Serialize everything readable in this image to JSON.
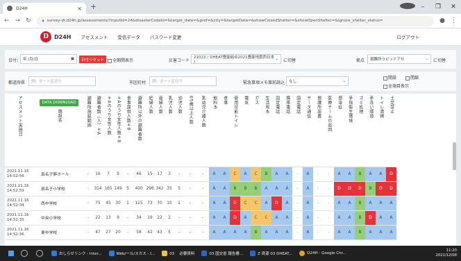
{
  "browser": {
    "tab_title": "D24H",
    "url": "survey-dr.d24h.jp/assessments/?inputId=24&disasterCodeId=&target_date=&pref=&city=&targetData=&showClosedShelter=&showOpenShelter=&ignore_shelter_status="
  },
  "nav": {
    "brand": "D24H",
    "links": [
      "アセスメント",
      "受信データ",
      "パスワード変更"
    ],
    "logout": "ログアウト"
  },
  "filters": {
    "date_label": "日付：",
    "date_value": "年 /月/日",
    "today_button": "日付リセット",
    "show_all_label": "全期間表示",
    "disaster_code_label": "災害コード",
    "disaster_code_value": "21023 ( DHEAT豊能組合2021豊能地震西日本 )",
    "copy_label": "に切替",
    "shelter_label": "拠点",
    "shelter_value": "避難所ラピッドアセ",
    "pref_label": "都道府県",
    "pref_placeholder": "例）ダ一ト区切り",
    "city_label": "市区町村",
    "city_placeholder": "例）ダ一ト区切り",
    "memo_label": "緊急事項メモ事前読込",
    "memo_value": "なし",
    "cb_open": "開設",
    "cb_closed": "閉鎖",
    "cb_all": "全項目表示"
  },
  "table": {
    "download_label": "DATA DOWNLOAD",
    "headers": {
      "date": "アセスメント実施日",
      "name": "施設名",
      "nums": [
        "避難所施設範囲",
        "避難者数（人）＊A",
        "＊Aのうち女性人数",
        "＊Aのうち女性人数＊B",
        "食事提供人数＊B",
        "避難所以外の避難者数",
        "妊婦人数",
        "産婦人数",
        "乳児人数",
        "幼児人数",
        "65歳以上人数",
        "乳幼児介護人数"
      ],
      "grades": [
        "飲料水",
        "食事",
        "使用可能トイレ",
        "電気",
        "ガス",
        "生活用水",
        "固定電話",
        "携帯電話",
        "固定電話",
        "データ通信",
        "救護所設置",
        "医療チームの巡回",
        "感染症",
        "手指衛生環境",
        "ゴミ処理",
        "手洗い環境",
        "トイレ清掃",
        "土足禁止"
      ]
    },
    "rows": [
      {
        "date": "2021.11.16",
        "time": "14:52:56",
        "name": "真名子夢ホール",
        "nums": [
          "-",
          "16",
          "7",
          "9",
          "-",
          "46",
          "15",
          "17",
          "3",
          "-",
          "-",
          "-"
        ],
        "grades": [
          "A",
          "A",
          "C",
          "A",
          "C",
          "B",
          "A",
          "A",
          "-",
          "A",
          "-",
          "-",
          "A",
          "A",
          "B",
          "A",
          "A",
          "D"
        ]
      },
      {
        "date": "2021.11.16",
        "time": "14:52:59",
        "name": "真名子小学校",
        "nums": [
          "-",
          "314",
          "165",
          "149",
          "5",
          "400",
          "298",
          "342",
          "35",
          "5",
          "-",
          "-"
        ],
        "grades": [
          "A",
          "A",
          "B",
          "B",
          "B",
          "A",
          "A",
          "A",
          "-",
          "A",
          "-",
          "-",
          "D",
          "D",
          "D",
          "B",
          "D",
          "D"
        ]
      },
      {
        "date": "2021.11.16",
        "time": "14:52:34",
        "name": "西中学校",
        "nums": [
          "-",
          "75",
          "45",
          "30",
          "1",
          "115",
          "73",
          "70",
          "10",
          "1",
          "-",
          "-"
        ],
        "grades": [
          "A",
          "A",
          "D",
          "C",
          "C",
          "A",
          "D",
          "A",
          "-",
          "A",
          "-",
          "-",
          "A",
          "A",
          "B",
          "A",
          "A",
          "A"
        ]
      },
      {
        "date": "2021.11.16",
        "time": "14:52:35",
        "name": "中央小学校",
        "nums": [
          "-",
          "22",
          "13",
          "9",
          "-",
          "34",
          "19",
          "22",
          "2",
          "-",
          "-",
          "-"
        ],
        "grades": [
          "A",
          "A",
          "D",
          "A",
          "C",
          "C",
          "A",
          "A",
          "-",
          "A",
          "-",
          "-",
          "A",
          "A",
          "B",
          "D",
          "A",
          "A"
        ]
      },
      {
        "date": "2021.11.16",
        "time": "14:52:36",
        "name": "東中学校",
        "nums": [
          "-",
          "47",
          "27",
          "20",
          "-",
          "58",
          "42",
          "43",
          "5",
          "-",
          "-",
          "-"
        ],
        "grades": [
          "A",
          "A",
          "A",
          "A",
          "B",
          "A",
          "A",
          "A",
          "-",
          "A",
          "-",
          "-",
          "A",
          "A",
          "B",
          "A",
          "A",
          "A"
        ]
      }
    ]
  },
  "taskbar": {
    "items": [
      "おしらせリンク - Inter...",
      "Web/ール/スカス - I...",
      "03 　必要資料",
      "03 国交省 報告書...",
      "Z 資源 03 DHEAT...",
      "D24H - Google Chr..."
    ],
    "time": "11:20",
    "date": "2021/12/08"
  },
  "colors": {
    "A": "#a5c8ee",
    "B": "#95cf7a",
    "C": "#f4c66b",
    "D": "#e5333a",
    "accent": "#d41e2a",
    "download": "#41a848"
  }
}
